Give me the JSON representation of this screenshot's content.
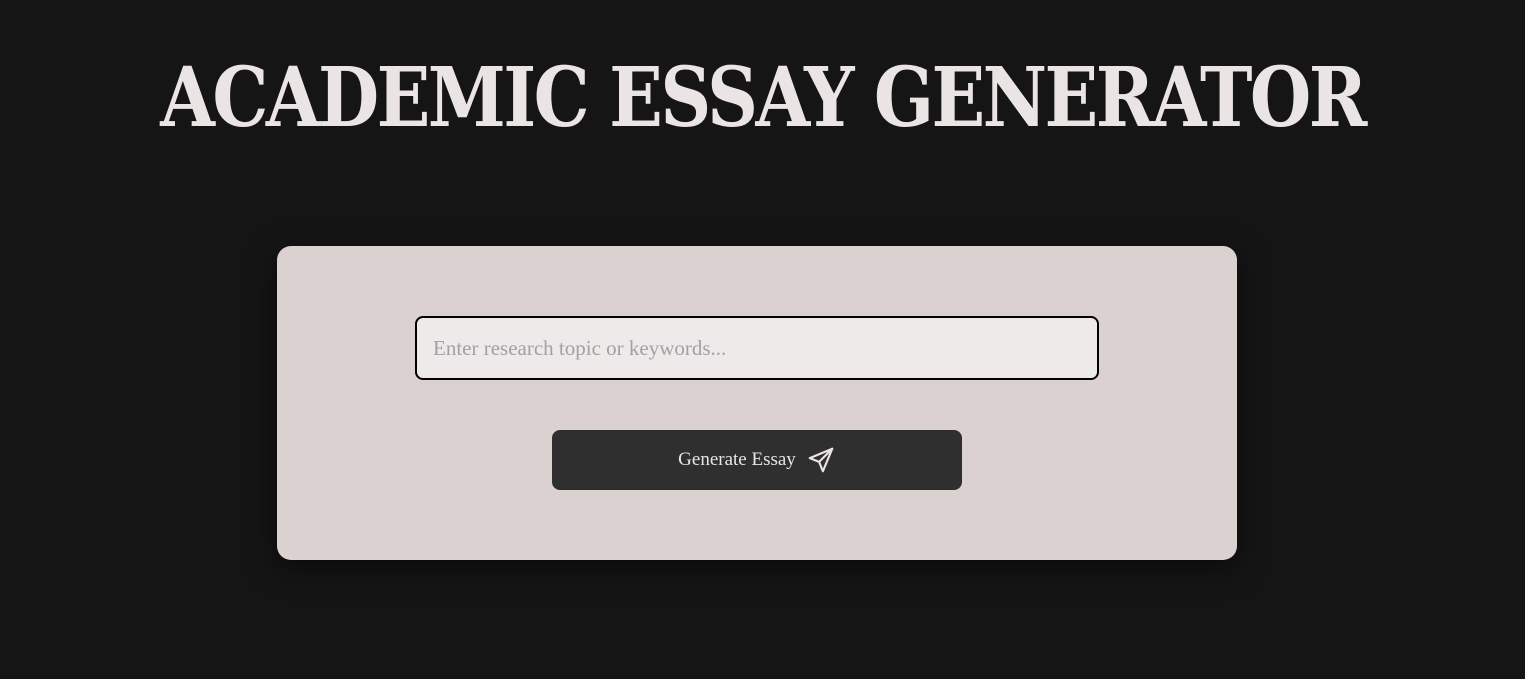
{
  "header": {
    "title": "ACADEMIC ESSAY GENERATOR"
  },
  "form": {
    "topic_input": {
      "value": "",
      "placeholder": "Enter research topic or keywords..."
    },
    "generate_button": {
      "label": "Generate Essay",
      "icon": "send-icon"
    }
  },
  "colors": {
    "background": "#151515",
    "title_text": "#ebe4e4",
    "card_background": "#dbd1d1",
    "input_background": "#eeeaea",
    "input_border": "#000000",
    "placeholder_text": "#a59ea6",
    "button_background": "#2f2f2f",
    "button_text": "#ebe4e4"
  }
}
